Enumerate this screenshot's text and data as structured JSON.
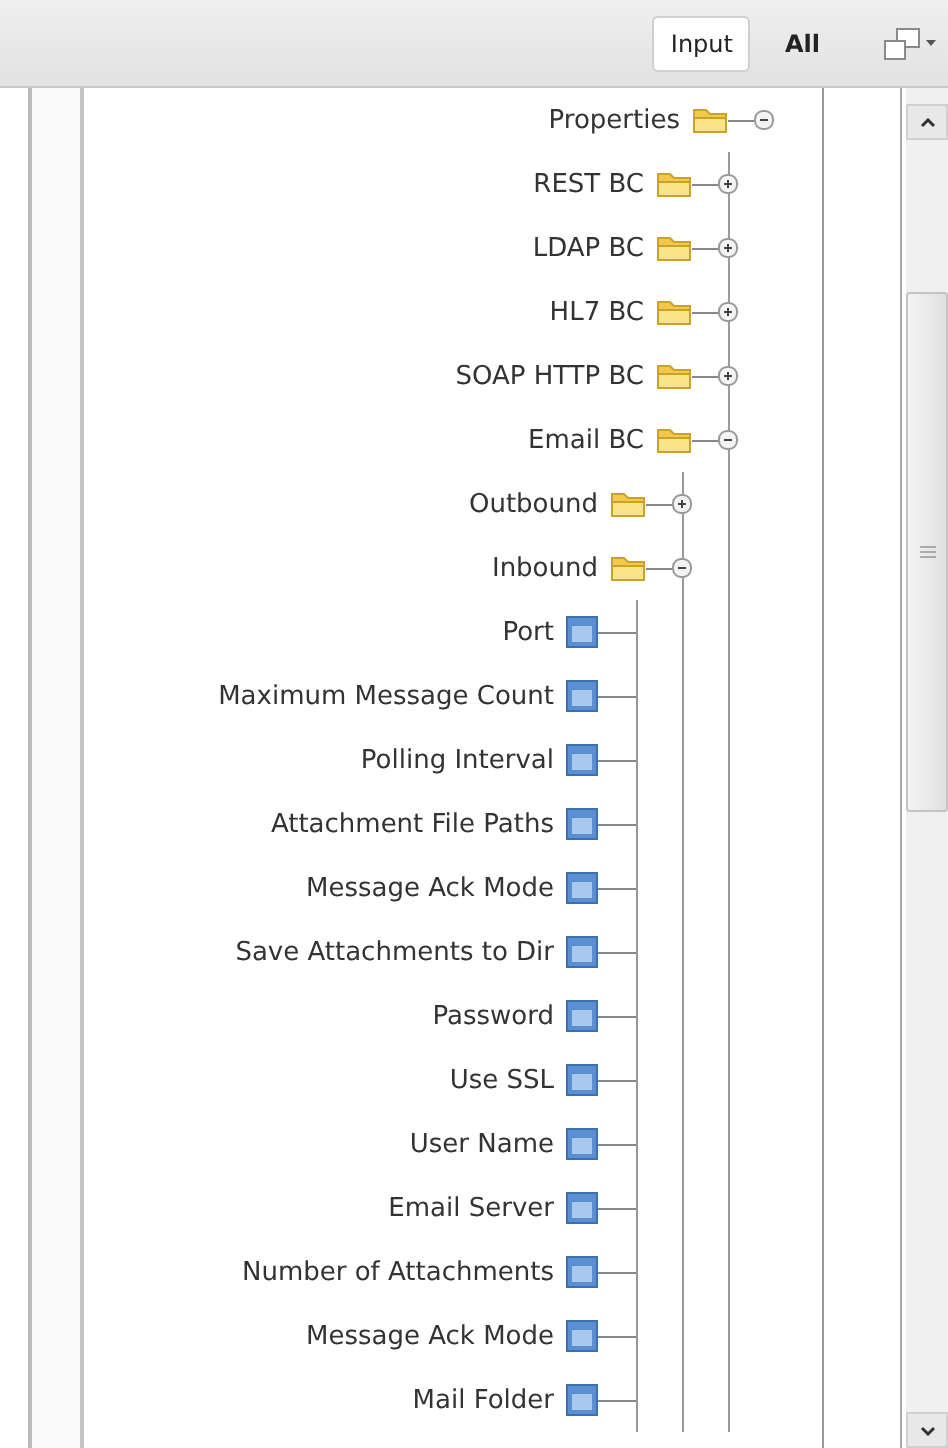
{
  "toolbar": {
    "tabs": [
      {
        "label": "Input",
        "selected": true
      },
      {
        "label": "All",
        "selected": false
      }
    ]
  },
  "tree": {
    "label": "Properties",
    "kind": "folder",
    "expanded": true,
    "children": [
      {
        "label": "REST BC",
        "kind": "folder",
        "expanded": false
      },
      {
        "label": "LDAP BC",
        "kind": "folder",
        "expanded": false
      },
      {
        "label": "HL7 BC",
        "kind": "folder",
        "expanded": false
      },
      {
        "label": "SOAP HTTP BC",
        "kind": "folder",
        "expanded": false
      },
      {
        "label": "Email BC",
        "kind": "folder",
        "expanded": true,
        "children": [
          {
            "label": "Outbound",
            "kind": "folder",
            "expanded": false
          },
          {
            "label": "Inbound",
            "kind": "folder",
            "expanded": true,
            "children": [
              {
                "label": "Port",
                "kind": "property"
              },
              {
                "label": "Maximum Message Count",
                "kind": "property"
              },
              {
                "label": "Polling Interval",
                "kind": "property"
              },
              {
                "label": "Attachment File Paths",
                "kind": "property"
              },
              {
                "label": "Message Ack Mode",
                "kind": "property"
              },
              {
                "label": "Save Attachments to Dir",
                "kind": "property"
              },
              {
                "label": "Password",
                "kind": "property"
              },
              {
                "label": "Use SSL",
                "kind": "property"
              },
              {
                "label": "User Name",
                "kind": "property"
              },
              {
                "label": "Email Server",
                "kind": "property"
              },
              {
                "label": "Number of Attachments",
                "kind": "property"
              },
              {
                "label": "Message Ack Mode",
                "kind": "property"
              },
              {
                "label": "Mail Folder",
                "kind": "property"
              }
            ]
          }
        ]
      }
    ]
  }
}
